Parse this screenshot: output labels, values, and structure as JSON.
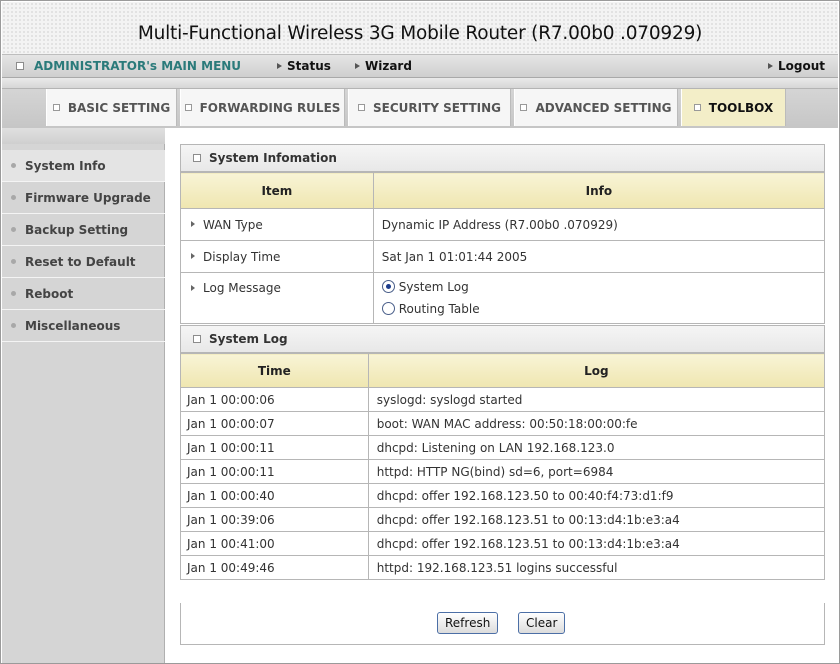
{
  "header": {
    "title": "Multi-Functional Wireless 3G Mobile Router (R7.00b0 .070929)"
  },
  "menu": {
    "admin": "ADMINISTRATOR's MAIN MENU",
    "status": "Status",
    "wizard": "Wizard",
    "logout": "Logout"
  },
  "tabs": [
    {
      "label": "BASIC SETTING"
    },
    {
      "label": "FORWARDING RULES"
    },
    {
      "label": "SECURITY SETTING"
    },
    {
      "label": "ADVANCED SETTING"
    },
    {
      "label": "TOOLBOX",
      "active": true
    }
  ],
  "sidebar": {
    "items": [
      {
        "label": "System Info",
        "selected": true
      },
      {
        "label": "Firmware Upgrade"
      },
      {
        "label": "Backup Setting"
      },
      {
        "label": "Reset to Default"
      },
      {
        "label": "Reboot"
      },
      {
        "label": "Miscellaneous"
      }
    ]
  },
  "system_info": {
    "heading": "System Infomation",
    "col_item": "Item",
    "col_info": "Info",
    "rows": [
      {
        "label": "WAN Type",
        "value": "Dynamic IP Address (R7.00b0 .070929)"
      },
      {
        "label": "Display Time",
        "value": "Sat Jan 1 01:01:44 2005"
      },
      {
        "label": "Log Message"
      }
    ],
    "log_options": [
      "System Log",
      "Routing Table"
    ],
    "selected_option": "System Log"
  },
  "system_log": {
    "heading": "System Log",
    "col_time": "Time",
    "col_log": "Log",
    "entries": [
      {
        "time": "Jan 1 00:00:06",
        "log": "syslogd: syslogd started"
      },
      {
        "time": "Jan 1 00:00:07",
        "log": "boot: WAN MAC address: 00:50:18:00:00:fe"
      },
      {
        "time": "Jan 1 00:00:11",
        "log": "dhcpd: Listening on LAN 192.168.123.0"
      },
      {
        "time": "Jan 1 00:00:11",
        "log": "httpd: HTTP NG(bind) sd=6, port=6984"
      },
      {
        "time": "Jan 1 00:00:40",
        "log": "dhcpd: offer 192.168.123.50 to 00:40:f4:73:d1:f9"
      },
      {
        "time": "Jan 1 00:39:06",
        "log": "dhcpd: offer 192.168.123.51 to 00:13:d4:1b:e3:a4"
      },
      {
        "time": "Jan 1 00:41:00",
        "log": "dhcpd: offer 192.168.123.51 to 00:13:d4:1b:e3:a4"
      },
      {
        "time": "Jan 1 00:49:46",
        "log": "httpd: 192.168.123.51 logins successful"
      }
    ]
  },
  "buttons": {
    "refresh": "Refresh",
    "clear": "Clear"
  }
}
